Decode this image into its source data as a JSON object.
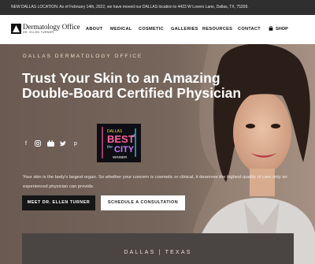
{
  "announcement": "NEW DALLAS LOCATION: As of February 14th, 2022, we have moved our DALLAS location to 4423 W Lovers Lane, Dallas, TX, 75209.",
  "logo": {
    "name": "Dermatology Office",
    "subtitle": "DR. ELLEN TURNER"
  },
  "nav": [
    "ABOUT",
    "MEDICAL",
    "COSMETIC",
    "GALLERIES",
    "RESOURCES",
    "CONTACT"
  ],
  "shop_label": "SHOP",
  "hero": {
    "eyebrow": "DALLAS DERMATOLOGY OFFICE",
    "headline": "Trust Your Skin to an Amazing Double-Board Certified Physician",
    "intro": "Your skin is the body's largest organ. So whether your concern is cosmetic or clinical, it deserves the highest quality of care only an experienced physician can provide.",
    "cta_primary": "MEET DR. ELLEN TURNER",
    "cta_secondary": "SCHEDULE A CONSULTATION"
  },
  "badge": {
    "top": "DALLAS",
    "main1": "BEST",
    "of": "of",
    "the": "the",
    "main2": "CITY",
    "winner": "WINNER"
  },
  "social_icons": [
    "facebook-icon",
    "instagram-icon",
    "youtube-icon",
    "twitter-icon",
    "pinterest-icon"
  ],
  "location_panel": {
    "label": "DALLAS | TEXAS"
  },
  "colors": {
    "accent": "#f1dfc7",
    "dark_button": "#151515",
    "announce_bar": "#2f2f2f"
  }
}
